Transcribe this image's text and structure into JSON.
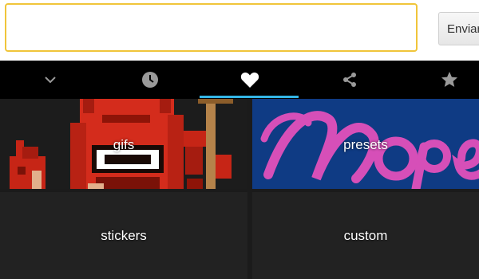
{
  "compose": {
    "message_value": "",
    "send_label": "Enviar"
  },
  "tabs": [
    {
      "icon": "chevron-down-icon"
    },
    {
      "icon": "clock-icon"
    },
    {
      "icon": "heart-icon",
      "selected": true
    },
    {
      "icon": "share-icon"
    },
    {
      "icon": "star-icon"
    }
  ],
  "tiles": [
    {
      "label": "gifs"
    },
    {
      "label": "presets"
    },
    {
      "label": "stickers"
    },
    {
      "label": "custom"
    }
  ],
  "colors": {
    "input_border": "#f0c53a",
    "tab_bar_bg": "#000000",
    "tab_indicator": "#33b5e5",
    "presets_bg": "#0f3b84",
    "presets_script": "#d64fb8",
    "demon_red": "#d42c1c"
  }
}
